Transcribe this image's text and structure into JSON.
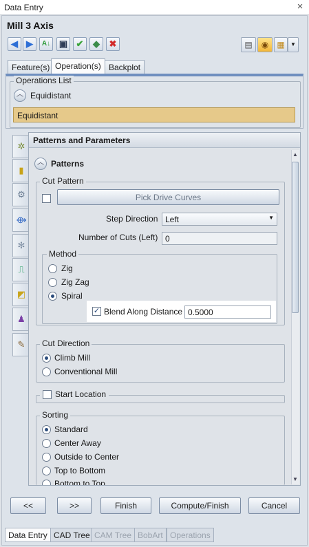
{
  "window": {
    "title": "Data Entry",
    "close_glyph": "×"
  },
  "main_title": "Mill 3 Axis",
  "toolbar": {
    "left_icons": [
      "arrow-left-icon",
      "arrow-right-icon",
      "all-down-icon",
      "save-icon",
      "check-icon",
      "verify-icon",
      "delete-icon"
    ],
    "right_icons": [
      "clipboard-icon",
      "eye-icon",
      "options-icon"
    ]
  },
  "tabs": [
    "Feature(s)",
    "Operation(s)",
    "Backplot"
  ],
  "operations": {
    "group_label": "Operations List",
    "header": "Equidistant",
    "selected_item": "Equidistant"
  },
  "panel": {
    "title": "Patterns and Parameters",
    "section": "Patterns"
  },
  "cut_pattern": {
    "group_label": "Cut Pattern",
    "pick_button": "Pick Drive Curves",
    "step_direction_label": "Step Direction",
    "step_direction_value": "Left",
    "num_cuts_label": "Number of Cuts (Left)",
    "num_cuts_value": "0",
    "method_label": "Method",
    "methods": [
      "Zig",
      "Zig Zag",
      "Spiral"
    ],
    "selected_method": "Spiral",
    "blend_label": "Blend Along Distance",
    "blend_value": "0.5000"
  },
  "cut_direction": {
    "group_label": "Cut Direction",
    "options": [
      "Climb Mill",
      "Conventional Mill"
    ],
    "selected": "Climb Mill"
  },
  "start_location": {
    "label": "Start Location"
  },
  "sorting": {
    "group_label": "Sorting",
    "options": [
      "Standard",
      "Center Away",
      "Outside to Center",
      "Top to Bottom",
      "Bottom to Top"
    ],
    "selected": "Standard"
  },
  "buttons": {
    "prev": "<<",
    "next": ">>",
    "finish": "Finish",
    "compute": "Compute/Finish",
    "cancel": "Cancel"
  },
  "bottom_tabs": [
    "Data Entry",
    "CAD Tree",
    "CAM Tree",
    "BobArt",
    "Operations"
  ]
}
